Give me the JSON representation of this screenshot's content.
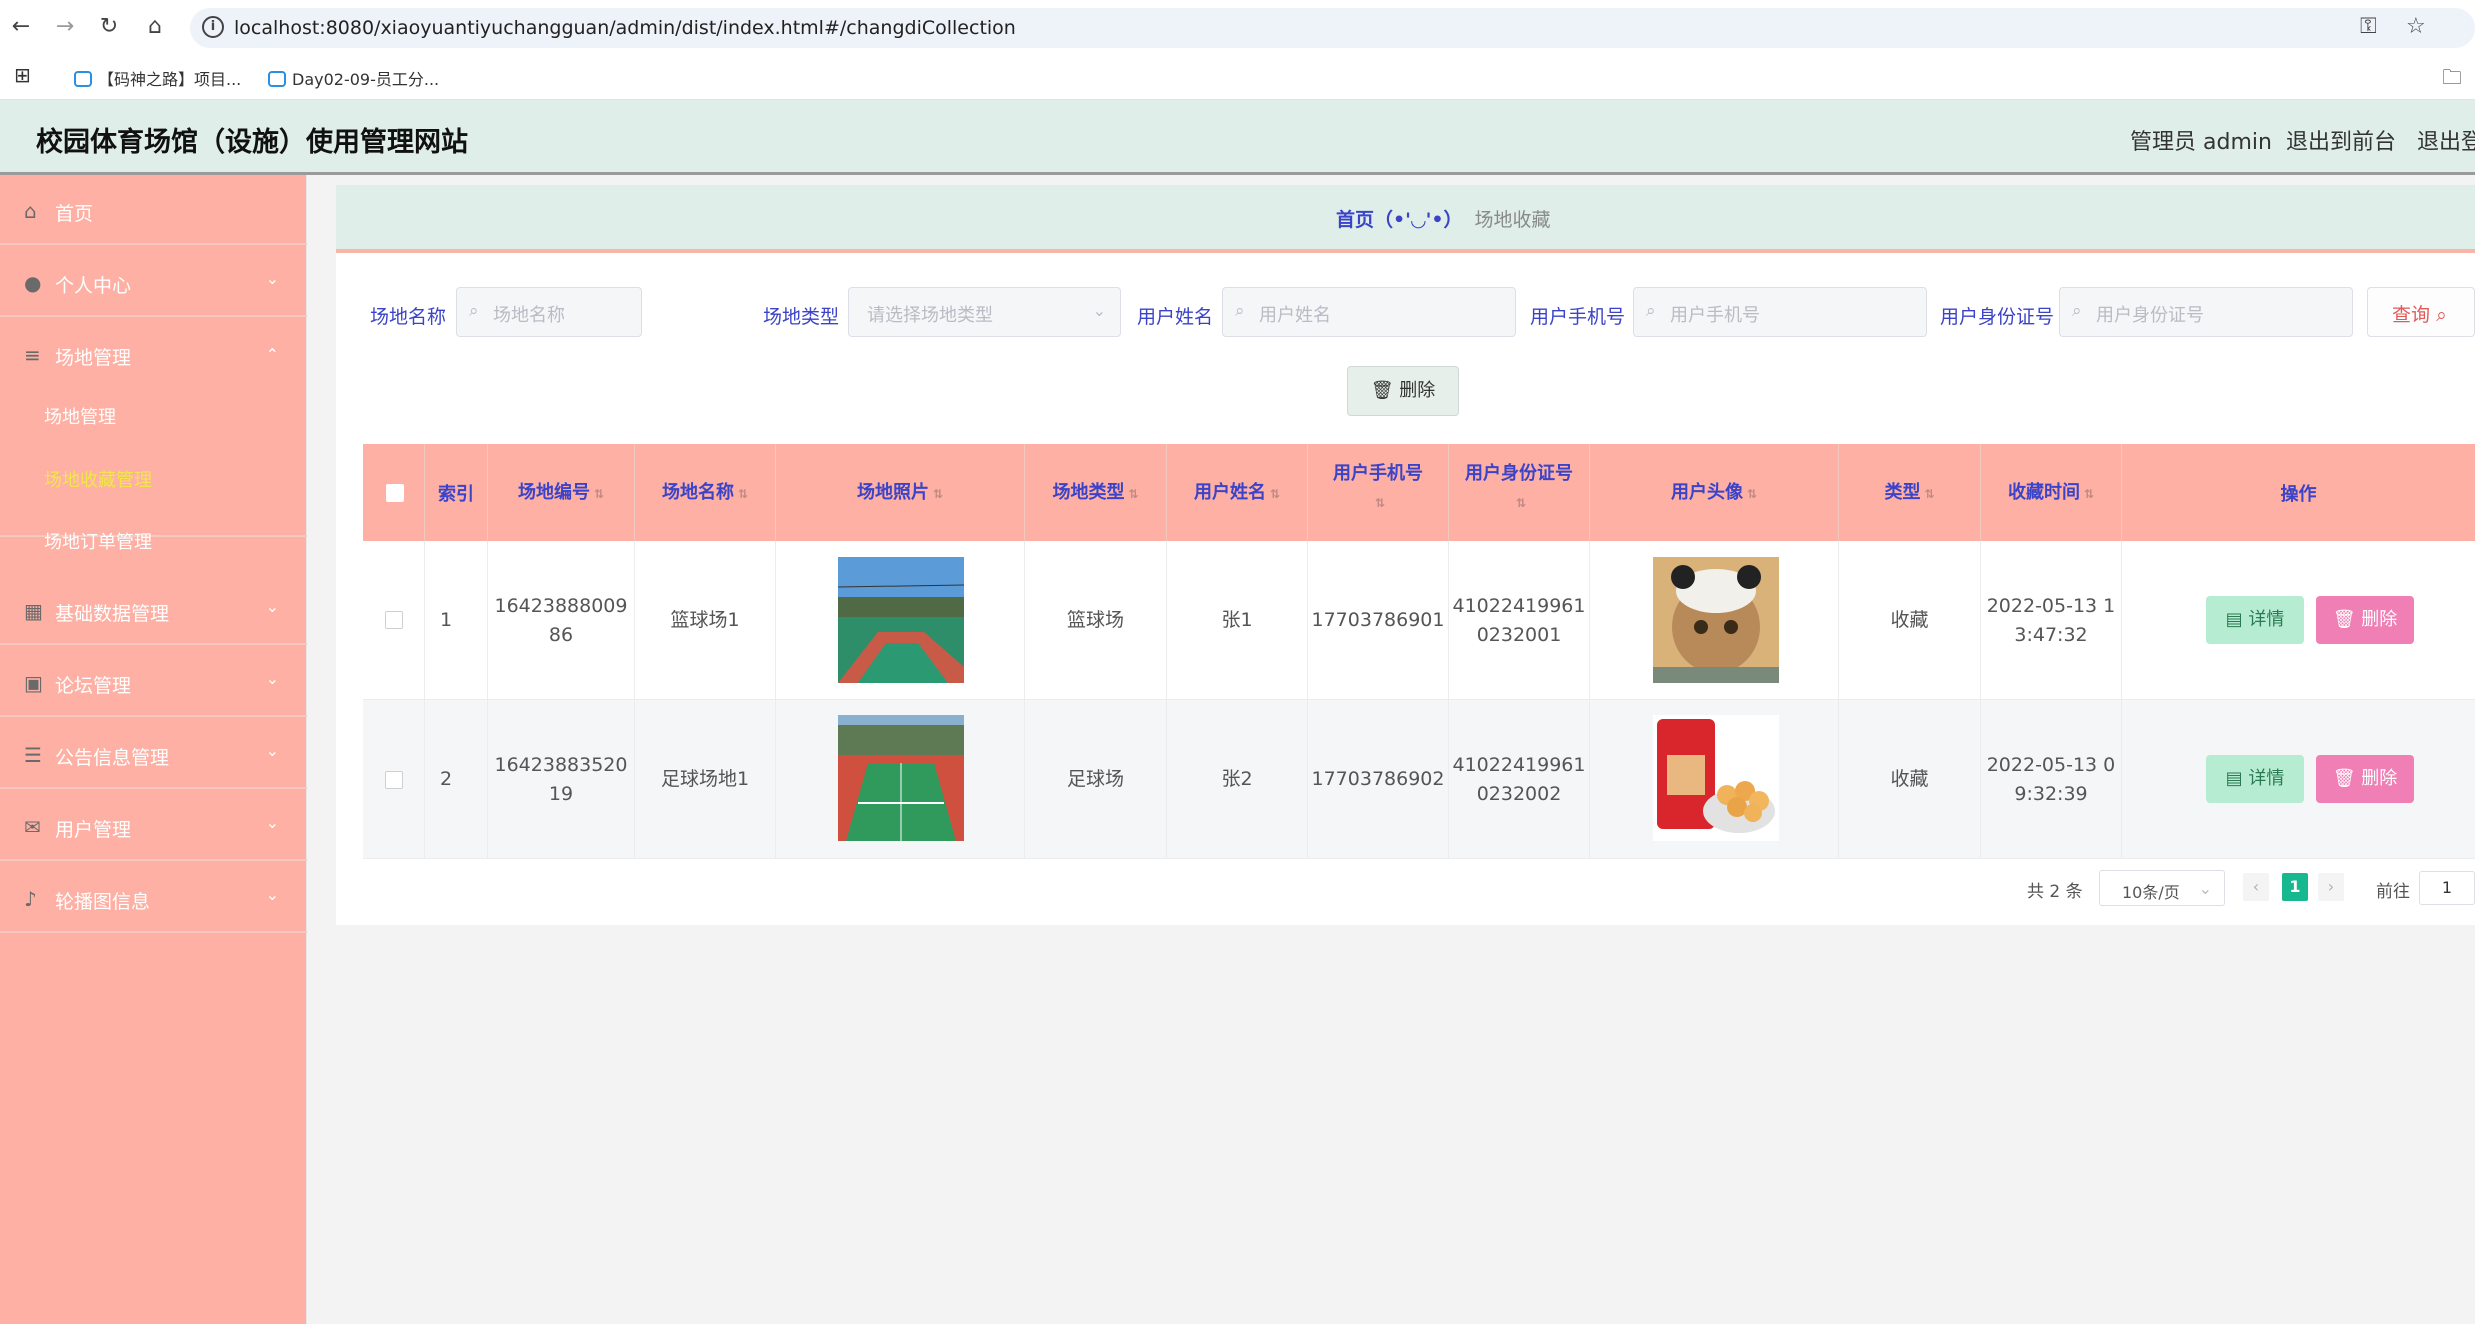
{
  "browser": {
    "url": "localhost:8080/xiaoyuantiyuchangguan/admin/dist/index.html#/changdiCollection",
    "bookmarks": [
      "【码神之路】项目...",
      "Day02-09-员工分..."
    ]
  },
  "header": {
    "title": "校园体育场馆（设施）使用管理网站",
    "admin_label": "管理员 admin",
    "exit_front": "退出到前台",
    "logout": "退出登"
  },
  "sidebar": {
    "items": [
      {
        "label": "首页",
        "icon": "home-icon"
      },
      {
        "label": "个人中心",
        "icon": "user-icon"
      },
      {
        "label": "场地管理",
        "icon": "menu-icon"
      },
      {
        "label": "基础数据管理",
        "icon": "grid-icon"
      },
      {
        "label": "论坛管理",
        "icon": "clipboard-icon"
      },
      {
        "label": "公告信息管理",
        "icon": "sliders-icon"
      },
      {
        "label": "用户管理",
        "icon": "mail-icon"
      },
      {
        "label": "轮播图信息",
        "icon": "mic-icon"
      }
    ],
    "subitems": [
      "场地管理",
      "场地收藏管理",
      "场地订单管理"
    ]
  },
  "breadcrumb": {
    "home": "首页（•'◡'•）",
    "current": "场地收藏"
  },
  "search": {
    "name_label": "场地名称",
    "name_placeholder": "场地名称",
    "type_label": "场地类型",
    "type_placeholder": "请选择场地类型",
    "user_label": "用户姓名",
    "user_placeholder": "用户姓名",
    "phone_label": "用户手机号",
    "phone_placeholder": "用户手机号",
    "id_label": "用户身份证号",
    "id_placeholder": "用户身份证号",
    "query_button": "查询"
  },
  "toolbar": {
    "delete_button": "删除"
  },
  "table": {
    "columns": [
      "索引",
      "场地编号",
      "场地名称",
      "场地照片",
      "场地类型",
      "用户姓名",
      "用户手机号",
      "用户身份证号",
      "用户头像",
      "类型",
      "收藏时间",
      "操作"
    ],
    "rows": [
      {
        "index": "1",
        "code_line1": "16423888009",
        "code_line2": "86",
        "name": "篮球场1",
        "type": "篮球场",
        "user": "张1",
        "phone": "17703786901",
        "idcard_line1": "41022419961",
        "idcard_line2": "0232001",
        "kind": "收藏",
        "time_line1": "2022-05-13 1",
        "time_line2": "3:47:32"
      },
      {
        "index": "2",
        "code_line1": "16423883520",
        "code_line2": "19",
        "name": "足球场地1",
        "type": "足球场",
        "user": "张2",
        "phone": "17703786902",
        "idcard_line1": "41022419961",
        "idcard_line2": "0232002",
        "kind": "收藏",
        "time_line1": "2022-05-13 0",
        "time_line2": "9:32:39"
      }
    ],
    "detail_button": "详情",
    "delete_button": "删除"
  },
  "pagination": {
    "total": "共 2 条",
    "page_size": "10条/页",
    "current_page": "1",
    "goto_label": "前往",
    "goto_value": "1"
  },
  "colors": {
    "sidebar": "#fdb0a3",
    "header": "#dfeee8",
    "label": "#3b43c8",
    "detail": "#b6ecd1",
    "delete": "#ef7fb4",
    "page_active": "#17b890"
  }
}
